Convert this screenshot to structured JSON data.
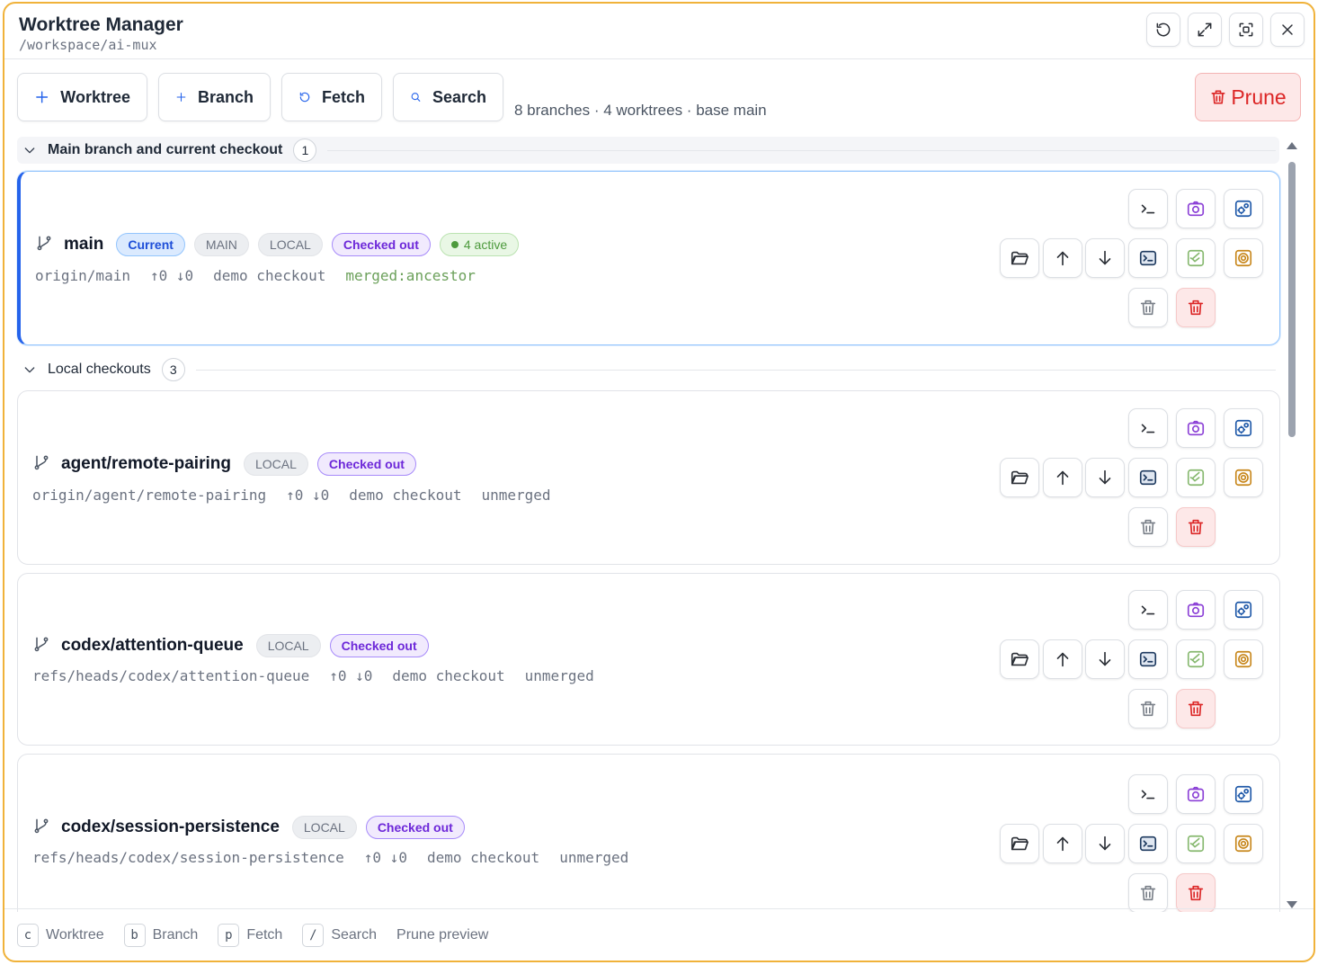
{
  "window": {
    "title": "Worktree Manager",
    "path": "/workspace/ai-mux",
    "controls": [
      "refresh-icon",
      "expand-icon",
      "focus-icon",
      "close-icon"
    ]
  },
  "toolbar": {
    "worktree_label": "Worktree",
    "branch_label": "Branch",
    "fetch_label": "Fetch",
    "search_label": "Search",
    "summary": "8 branches · 4 worktrees · base main",
    "prune_label": "Prune"
  },
  "sections": [
    {
      "title": "Main branch and current checkout",
      "count": "1",
      "items": [
        {
          "name": "main",
          "badges": {
            "current": "Current",
            "main": "MAIN",
            "local": "LOCAL",
            "checked": "Checked out",
            "active": "4 active"
          },
          "upstream": "origin/main",
          "sync": "↑0 ↓0",
          "checkout": "demo checkout",
          "merge": "merged:ancestor"
        }
      ]
    },
    {
      "title": "Local checkouts",
      "count": "3",
      "items": [
        {
          "name": "agent/remote-pairing",
          "badges": {
            "local": "LOCAL",
            "checked": "Checked out"
          },
          "upstream": "origin/agent/remote-pairing",
          "sync": "↑0 ↓0",
          "checkout": "demo checkout",
          "merge": "unmerged"
        },
        {
          "name": "codex/attention-queue",
          "badges": {
            "local": "LOCAL",
            "checked": "Checked out"
          },
          "upstream": "refs/heads/codex/attention-queue",
          "sync": "↑0 ↓0",
          "checkout": "demo checkout",
          "merge": "unmerged"
        },
        {
          "name": "codex/session-persistence",
          "badges": {
            "local": "LOCAL",
            "checked": "Checked out"
          },
          "upstream": "refs/heads/codex/session-persistence",
          "sync": "↑0 ↓0",
          "checkout": "demo checkout",
          "merge": "unmerged"
        }
      ]
    }
  ],
  "footer": {
    "hints": [
      {
        "key": "c",
        "label": "Worktree"
      },
      {
        "key": "b",
        "label": "Branch"
      },
      {
        "key": "p",
        "label": "Fetch"
      },
      {
        "key": "/",
        "label": "Search"
      }
    ],
    "extra": "Prune preview"
  },
  "colors": {
    "window_border": "#f0b23a",
    "accent_blue": "#2563eb",
    "danger_red": "#dc2626",
    "checked_purple": "#6d28d9",
    "active_green": "#4d9a3d"
  }
}
